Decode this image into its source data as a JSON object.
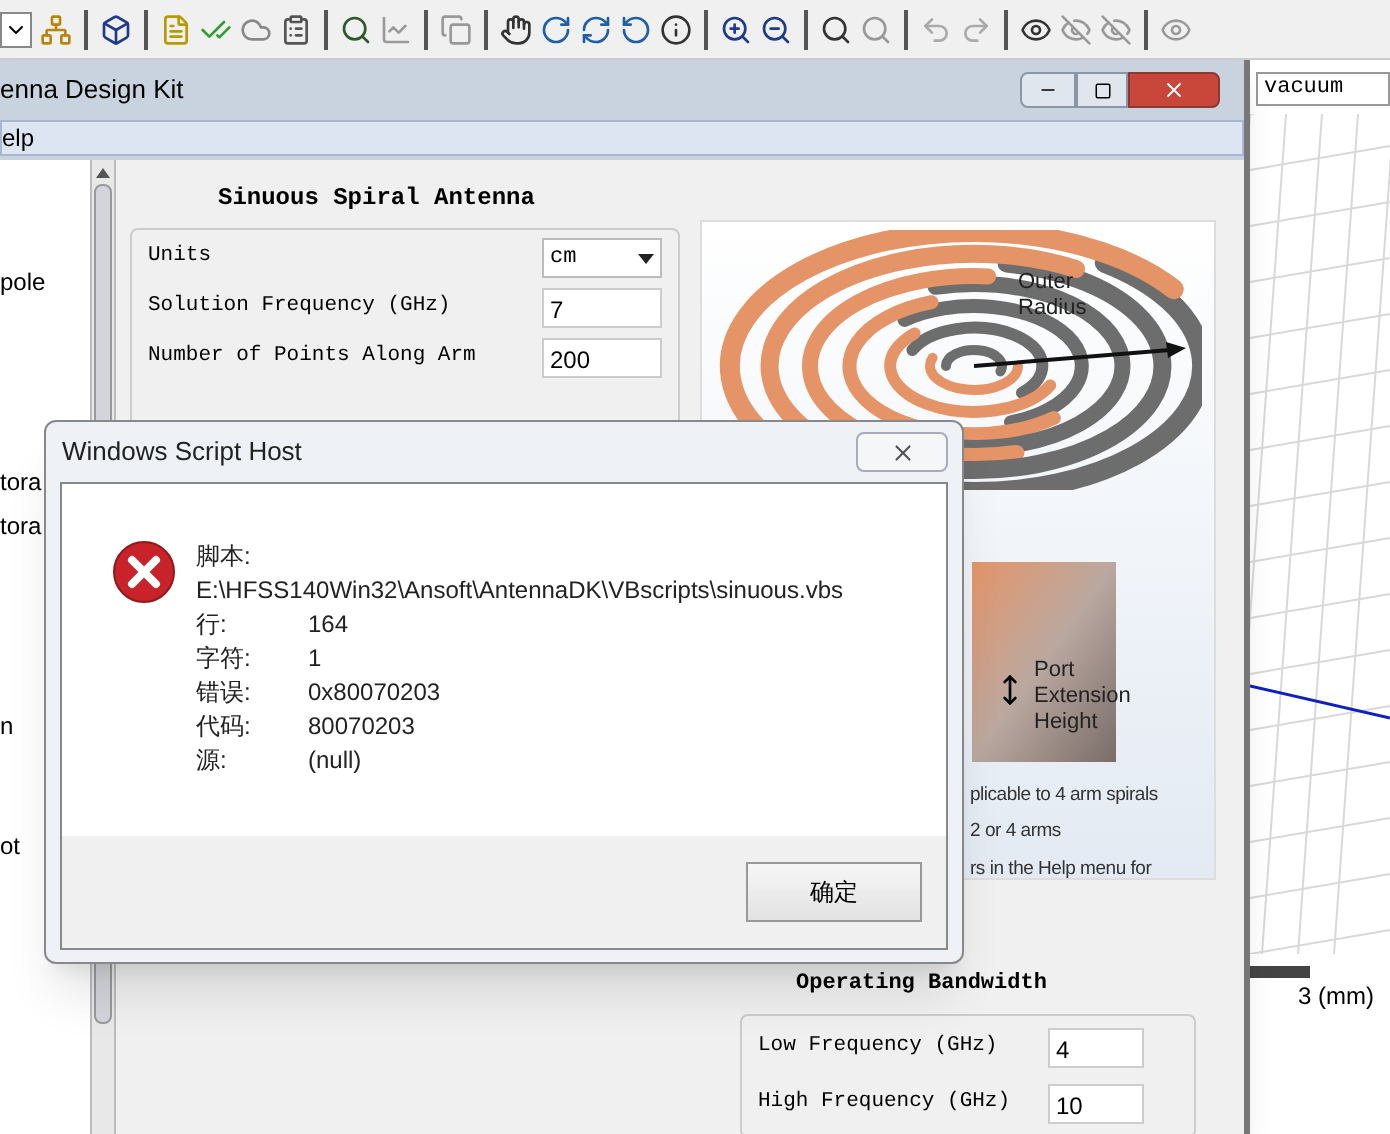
{
  "material_field": {
    "value": "vacuum"
  },
  "scale_label": "3 (mm)",
  "window": {
    "title": "enna Design Kit",
    "menu": [
      "elp"
    ],
    "tree_items": [
      "pole",
      "tora",
      "tora",
      "n",
      "ot"
    ],
    "panel_title": "Sinuous Spiral Antenna",
    "fields": [
      {
        "kind": "select",
        "label": "Units",
        "value": "cm"
      },
      {
        "kind": "input",
        "label": "Solution Frequency (GHz)",
        "value": "7"
      },
      {
        "kind": "input",
        "label": "Number of Points Along Arm",
        "value": "200"
      }
    ],
    "figure": {
      "outer_label": "Outer Radius",
      "port_label": "Port Extension Height",
      "notes": [
        "plicable to 4 arm spirals",
        "2 or 4 arms",
        "rs in the Help menu for"
      ]
    },
    "bandwidth": {
      "title": "Operating Bandwidth",
      "fields": [
        {
          "label": "Low Frequency (GHz)",
          "value": "4"
        },
        {
          "label": "High Frequency (GHz)",
          "value": "10"
        }
      ]
    }
  },
  "dialog": {
    "title": "Windows Script Host",
    "rows": [
      {
        "label": "脚本:",
        "value": "E:\\HFSS140Win32\\Ansoft\\AntennaDK\\VBscripts\\sinuous.vbs",
        "kind": "block"
      },
      {
        "label": "行:",
        "value": "164",
        "kind": "inline"
      },
      {
        "label": "字符:",
        "value": "1",
        "kind": "inline"
      },
      {
        "label": "错误:",
        "value": "0x80070203",
        "kind": "inline"
      },
      {
        "label": "代码:",
        "value": "80070203",
        "kind": "inline"
      },
      {
        "label": "源:",
        "value": "(null)",
        "kind": "inline"
      }
    ],
    "button": "确定"
  }
}
